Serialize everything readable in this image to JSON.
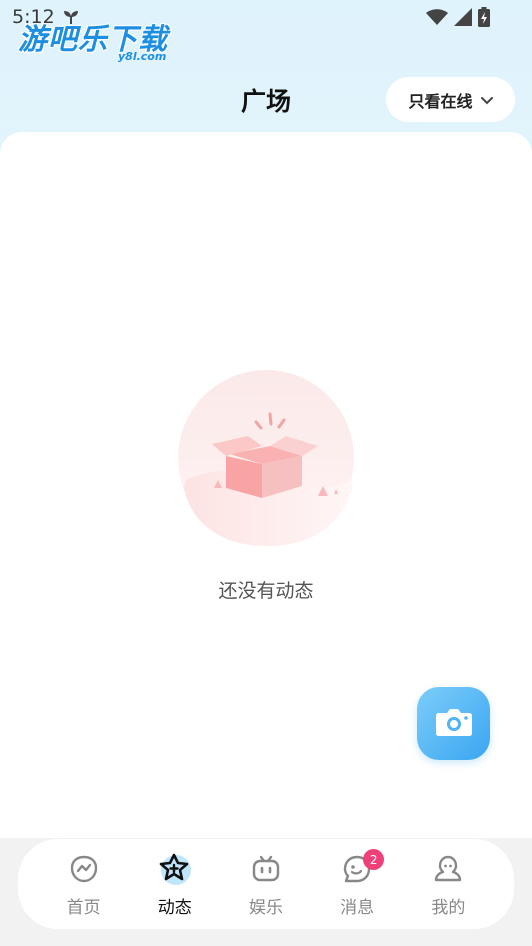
{
  "status_bar": {
    "time": "5:12",
    "icons": [
      "plant-icon",
      "wifi-icon",
      "signal-icon",
      "battery-icon"
    ]
  },
  "watermark": {
    "title": "游吧乐下载",
    "subtitle": "y8l.com"
  },
  "header": {
    "title": "广场",
    "filter_label": "只看在线",
    "filter_icon": "chevron-down-icon"
  },
  "empty_state": {
    "message": "还没有动态",
    "icon": "empty-box-icon"
  },
  "fab": {
    "icon": "camera-icon"
  },
  "bottom_nav": {
    "items": [
      {
        "label": "首页",
        "icon": "home-icon",
        "active": false
      },
      {
        "label": "动态",
        "icon": "star-icon",
        "active": true
      },
      {
        "label": "娱乐",
        "icon": "tv-icon",
        "active": false
      },
      {
        "label": "消息",
        "icon": "message-icon",
        "active": false,
        "badge": "2"
      },
      {
        "label": "我的",
        "icon": "profile-icon",
        "active": false
      }
    ]
  },
  "colors": {
    "accent": "#3aa6f0",
    "badge": "#f0407a",
    "header_bg": "#e3f4fb"
  }
}
